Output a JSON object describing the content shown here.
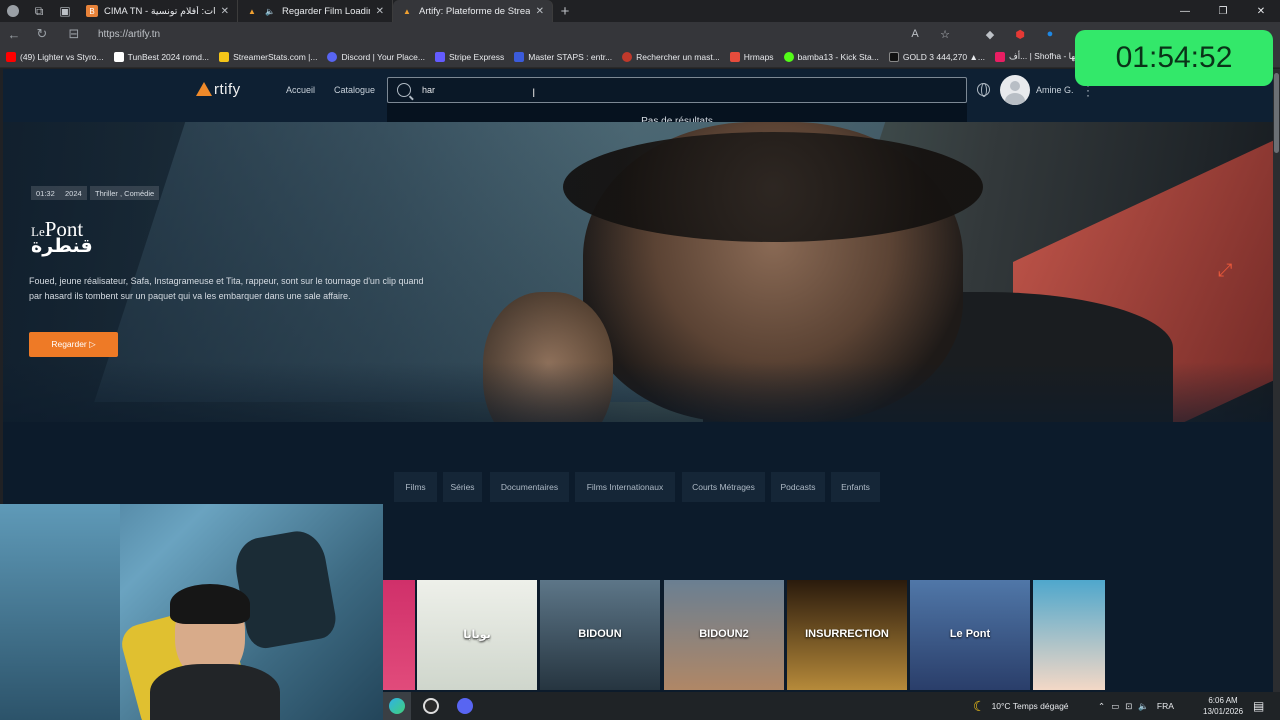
{
  "browser": {
    "tabs": [
      {
        "label": "CIMA TN - التسميات: أفلام تونسية",
        "icon_color": "#e8833a"
      },
      {
        "label": "Regarder Film Loading - Ar",
        "icon_color": "#f0a030"
      },
      {
        "label": "Artify: Plateforme de Streaming",
        "icon_color": "#f0a030"
      }
    ],
    "url": "https://artify.tn",
    "bookmarks": [
      {
        "label": "(49) Lighter vs Styro...",
        "color": "#ff0000"
      },
      {
        "label": "TunBest 2024 romd...",
        "color": "#ffffff"
      },
      {
        "label": "StreamerStats.com |...",
        "color": "#f5c518"
      },
      {
        "label": "Discord | Your Place...",
        "color": "#5865f2"
      },
      {
        "label": "Stripe Express",
        "color": "#635bff"
      },
      {
        "label": "Master STAPS : entr...",
        "color": "#3b5bdb"
      },
      {
        "label": "Rechercher un mast...",
        "color": "#c0392b"
      },
      {
        "label": "Hrmaps",
        "color": "#e74c3c"
      },
      {
        "label": "bamba13 - Kick Sta...",
        "color": "#53fc18"
      },
      {
        "label": "GOLD 3 444,270 ▲...",
        "color": "#111111"
      },
      {
        "label": "أف... | Shofha - شوفها",
        "color": "#e91e63"
      }
    ]
  },
  "timer": "01:54:52",
  "site": {
    "logo_text": "rtify",
    "nav": {
      "home": "Accueil",
      "catalog": "Catalogue"
    },
    "search": {
      "value": "har",
      "no_results": "Pas de résultats"
    },
    "user_name": "Amine G.",
    "hero": {
      "tags": [
        "01:32",
        "2024",
        "Thriller , Comédie"
      ],
      "title_fr_small": "Le",
      "title_fr_big": "Pont",
      "title_ar": "قنطرة",
      "description": "Foued, jeune réalisateur, Safa, Instagrameuse et Tita, rappeur, sont sur le tournage d'un clip quand par hasard ils tombent sur un paquet qui va les embarquer dans une sale affaire.",
      "watch_label": "Regarder ▷"
    },
    "categories": [
      "Films",
      "Séries",
      "Documentaires",
      "Films Internationaux",
      "Courts Métrages",
      "Podcasts",
      "Enfants"
    ],
    "posters": [
      {
        "title": "",
        "colors": [
          "#d0306a",
          "#e14b7b"
        ]
      },
      {
        "title": "بوبابا",
        "colors": [
          "#eef0ea",
          "#cfd6cc"
        ]
      },
      {
        "title": "BIDOUN",
        "colors": [
          "#5d7688",
          "#263540"
        ]
      },
      {
        "title": "BIDOUN2",
        "colors": [
          "#6a7f92",
          "#b08766"
        ]
      },
      {
        "title": "INSURRECTION",
        "colors": [
          "#2a1a0c",
          "#b68a3a"
        ]
      },
      {
        "title": "Le Pont",
        "colors": [
          "#5077a8",
          "#2a3e6a"
        ]
      },
      {
        "title": "",
        "colors": [
          "#4fa7cc",
          "#f3d8c6"
        ]
      }
    ]
  },
  "taskbar": {
    "weather": "10°C  Temps dégagé",
    "lang": "FRA",
    "time": "6:06 AM",
    "date": "13/01/2026"
  }
}
